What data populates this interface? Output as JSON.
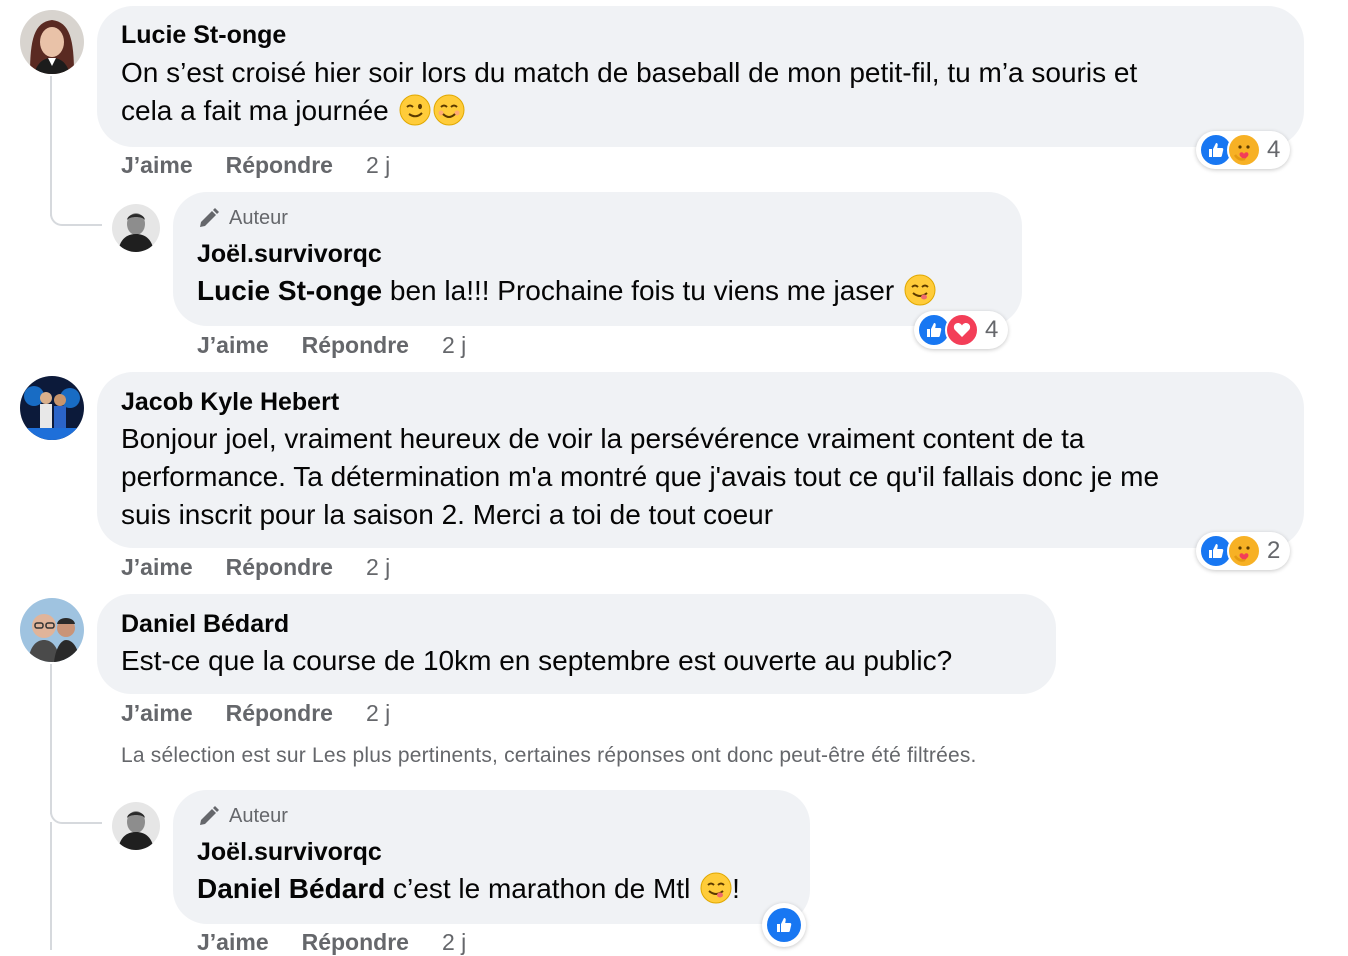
{
  "comments": [
    {
      "name": "Lucie St-onge",
      "text_line1": "On s’est croisé hier soir lors du match de baseball de mon petit-fil, tu m’a souris et",
      "text_line2": "cela a fait ma journée",
      "like": "J’aime",
      "reply": "Répondre",
      "time": "2 j",
      "reaction_count": "4",
      "reply_item": {
        "badge": "Auteur",
        "name": "Joël.survivorqc",
        "mention": "Lucie St-onge",
        "text": " ben la!!! Prochaine fois tu viens me jaser",
        "like": "J’aime",
        "reply": "Répondre",
        "time": "2 j",
        "reaction_count": "4"
      }
    },
    {
      "name": "Jacob Kyle Hebert",
      "text_line1": "Bonjour joel, vraiment heureux de voir la persévérence vraiment content de ta",
      "text_line2": "performance. Ta détermination m'a montré que j'avais tout ce qu'il fallais donc je me",
      "text_line3": "suis inscrit pour la saison 2. Merci a toi de tout coeur",
      "like": "J’aime",
      "reply": "Répondre",
      "time": "2 j",
      "reaction_count": "2"
    },
    {
      "name": "Daniel Bédard",
      "text": "Est-ce que la course de 10km en septembre est ouverte au public?",
      "like": "J’aime",
      "reply": "Répondre",
      "time": "2 j",
      "notice": "La sélection est sur Les plus pertinents, certaines réponses ont donc peut-être été filtrées.",
      "reply_item": {
        "badge": "Auteur",
        "name": "Joël.survivorqc",
        "mention": "Daniel Bédard",
        "text": " c’est le marathon de Mtl",
        "text_end": "!",
        "like": "J’aime",
        "reply": "Répondre",
        "time": "2 j"
      }
    }
  ],
  "colors": {
    "bubble": "#f0f2f5",
    "secondary_text": "#65676b",
    "like_blue": "#1877f2",
    "love_red": "#f33e58",
    "care_yellow": "#f7b125"
  },
  "icons": [
    "like-reaction-icon",
    "care-reaction-icon",
    "love-reaction-icon",
    "pen-author-icon",
    "wink-emoji",
    "smile-emoji",
    "yum-emoji"
  ]
}
